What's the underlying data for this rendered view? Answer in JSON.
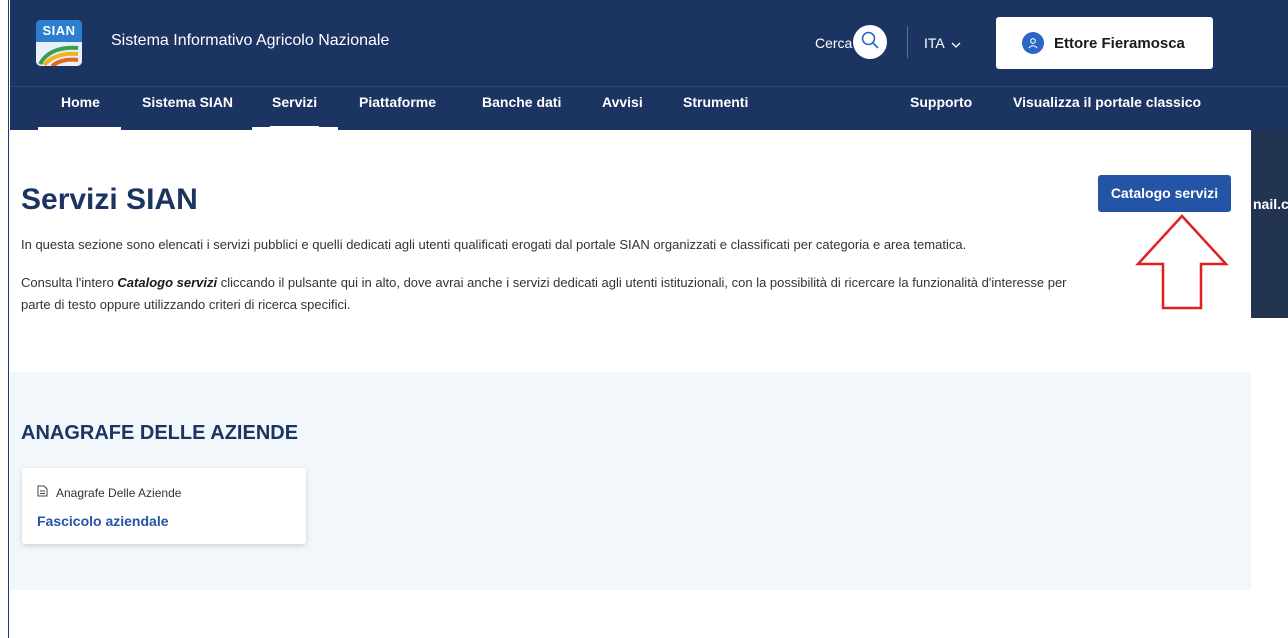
{
  "header": {
    "logo_text": "SIAN",
    "site_title": "Sistema Informativo Agricolo Nazionale",
    "search_label": "Cerca",
    "language": "ITA",
    "user_name": "Ettore Fieramosca"
  },
  "nav": {
    "items": [
      {
        "label": "Home"
      },
      {
        "label": "Sistema SIAN"
      },
      {
        "label": "Servizi"
      },
      {
        "label": "Piattaforme"
      },
      {
        "label": "Banche dati"
      },
      {
        "label": "Avvisi"
      },
      {
        "label": "Strumenti"
      },
      {
        "label": "Supporto"
      },
      {
        "label": "Visualizza il portale classico"
      }
    ],
    "active": "Servizi"
  },
  "main": {
    "title": "Servizi SIAN",
    "intro1": "In questa sezione sono elencati i servizi pubblici e quelli dedicati agli utenti qualificati erogati dal portale SIAN organizzati e classificati per categoria e area tematica.",
    "intro2_prefix": "Consulta l'intero ",
    "intro2_emph": "Catalogo servizi",
    "intro2_suffix": " cliccando il pulsante qui in alto, dove avrai anche i servizi dedicati agli utenti istituzionali, con la possibilità di ricercare la funzionalità d'interesse per parte di testo oppure utilizzando criteri di ricerca specifici.",
    "catalog_button": "Catalogo servizi"
  },
  "right_panel": {
    "partial_text": "nail.co"
  },
  "section": {
    "title": "ANAGRAFE DELLE AZIENDE",
    "card": {
      "category": "Anagrafe Delle Aziende",
      "link": "Fascicolo aziendale"
    }
  },
  "colors": {
    "header_bg": "#1c3461",
    "accent": "#2454a6",
    "section_bg": "#f2f7fc",
    "annotation_arrow": "#e02020"
  },
  "icons": {
    "search": "search-icon",
    "language_chevron": "chevron-down-icon",
    "user": "user-icon",
    "card_category": "document-icon",
    "annotation": "arrow-up-annotation"
  }
}
